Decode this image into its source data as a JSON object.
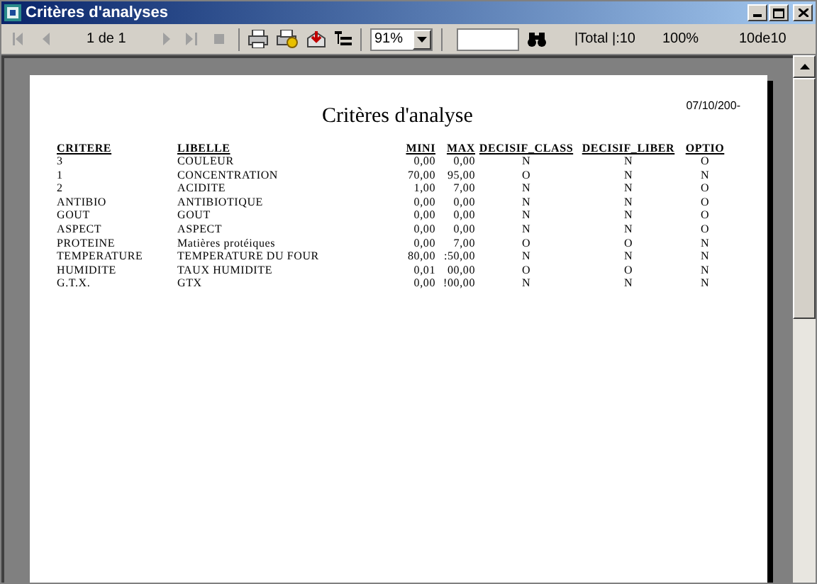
{
  "window": {
    "title": "Critères d'analyses"
  },
  "toolbar": {
    "page_indicator": "1 de 1",
    "zoom": "91%",
    "total": "|Total |:10",
    "percent": "100%",
    "count": "10de10"
  },
  "report": {
    "title": "Critères d'analyse",
    "date": "07/10/200-",
    "table": {
      "columns": [
        "CRITERE",
        "LIBELLE",
        "MINI",
        "MAX",
        "DECISIF_CLASS",
        "DECISIF_LIBER",
        "OPTIO"
      ],
      "rows": [
        [
          "3",
          "COULEUR",
          "0,00",
          "0,00",
          "N",
          "N",
          "O"
        ],
        [
          "1",
          "CONCENTRATION",
          "70,00",
          "95,00",
          "O",
          "N",
          "N"
        ],
        [
          "2",
          "ACIDITE",
          "1,00",
          "7,00",
          "N",
          "N",
          "O"
        ],
        [
          "ANTIBIO",
          "ANTIBIOTIQUE",
          "0,00",
          "0,00",
          "N",
          "N",
          "O"
        ],
        [
          "GOUT",
          "GOUT",
          "0,00",
          "0,00",
          "N",
          "N",
          "O"
        ],
        [
          "ASPECT",
          "ASPECT",
          "0,00",
          "0,00",
          "N",
          "N",
          "O"
        ],
        [
          "PROTEINE",
          "Matières protéiques",
          "0,00",
          "7,00",
          "O",
          "O",
          "N"
        ],
        [
          "TEMPERATURE",
          "TEMPERATURE DU FOUR",
          "80,00",
          ":50,00",
          "N",
          "N",
          "N"
        ],
        [
          "HUMIDITE",
          "TAUX HUMIDITE",
          "0,01",
          "00,00",
          "O",
          "O",
          "N"
        ],
        [
          "G.T.X.",
          "GTX",
          "0,00",
          "!00,00",
          "N",
          "N",
          "N"
        ]
      ]
    }
  }
}
